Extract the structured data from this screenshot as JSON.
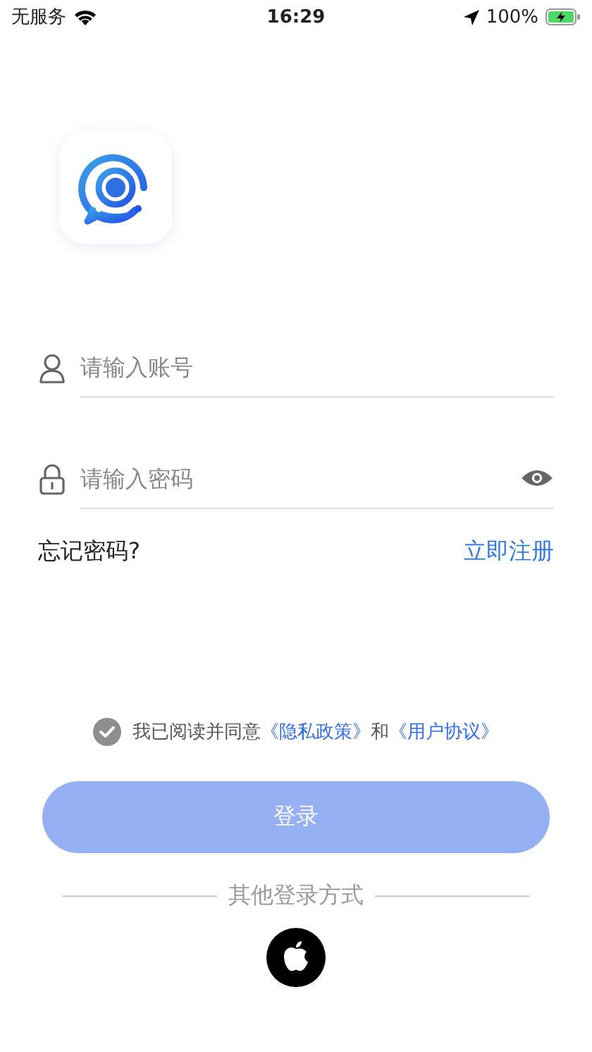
{
  "status_bar": {
    "carrier": "无服务",
    "time": "16:29",
    "battery": "100%"
  },
  "account_field": {
    "placeholder": "请输入账号"
  },
  "password_field": {
    "placeholder": "请输入密码"
  },
  "forgot_password": "忘记密码?",
  "register_link": "立即注册",
  "agreement": {
    "checked": true,
    "parts": [
      {
        "kind": "text",
        "text": "我已阅读并同意"
      },
      {
        "kind": "link",
        "text": "《隐私政策》"
      },
      {
        "kind": "text",
        "text": "和"
      },
      {
        "kind": "link",
        "text": "《用户协议》"
      }
    ]
  },
  "login_button": {
    "label": "登录",
    "disabled": true
  },
  "other_login": {
    "title": "其他登录方式"
  }
}
